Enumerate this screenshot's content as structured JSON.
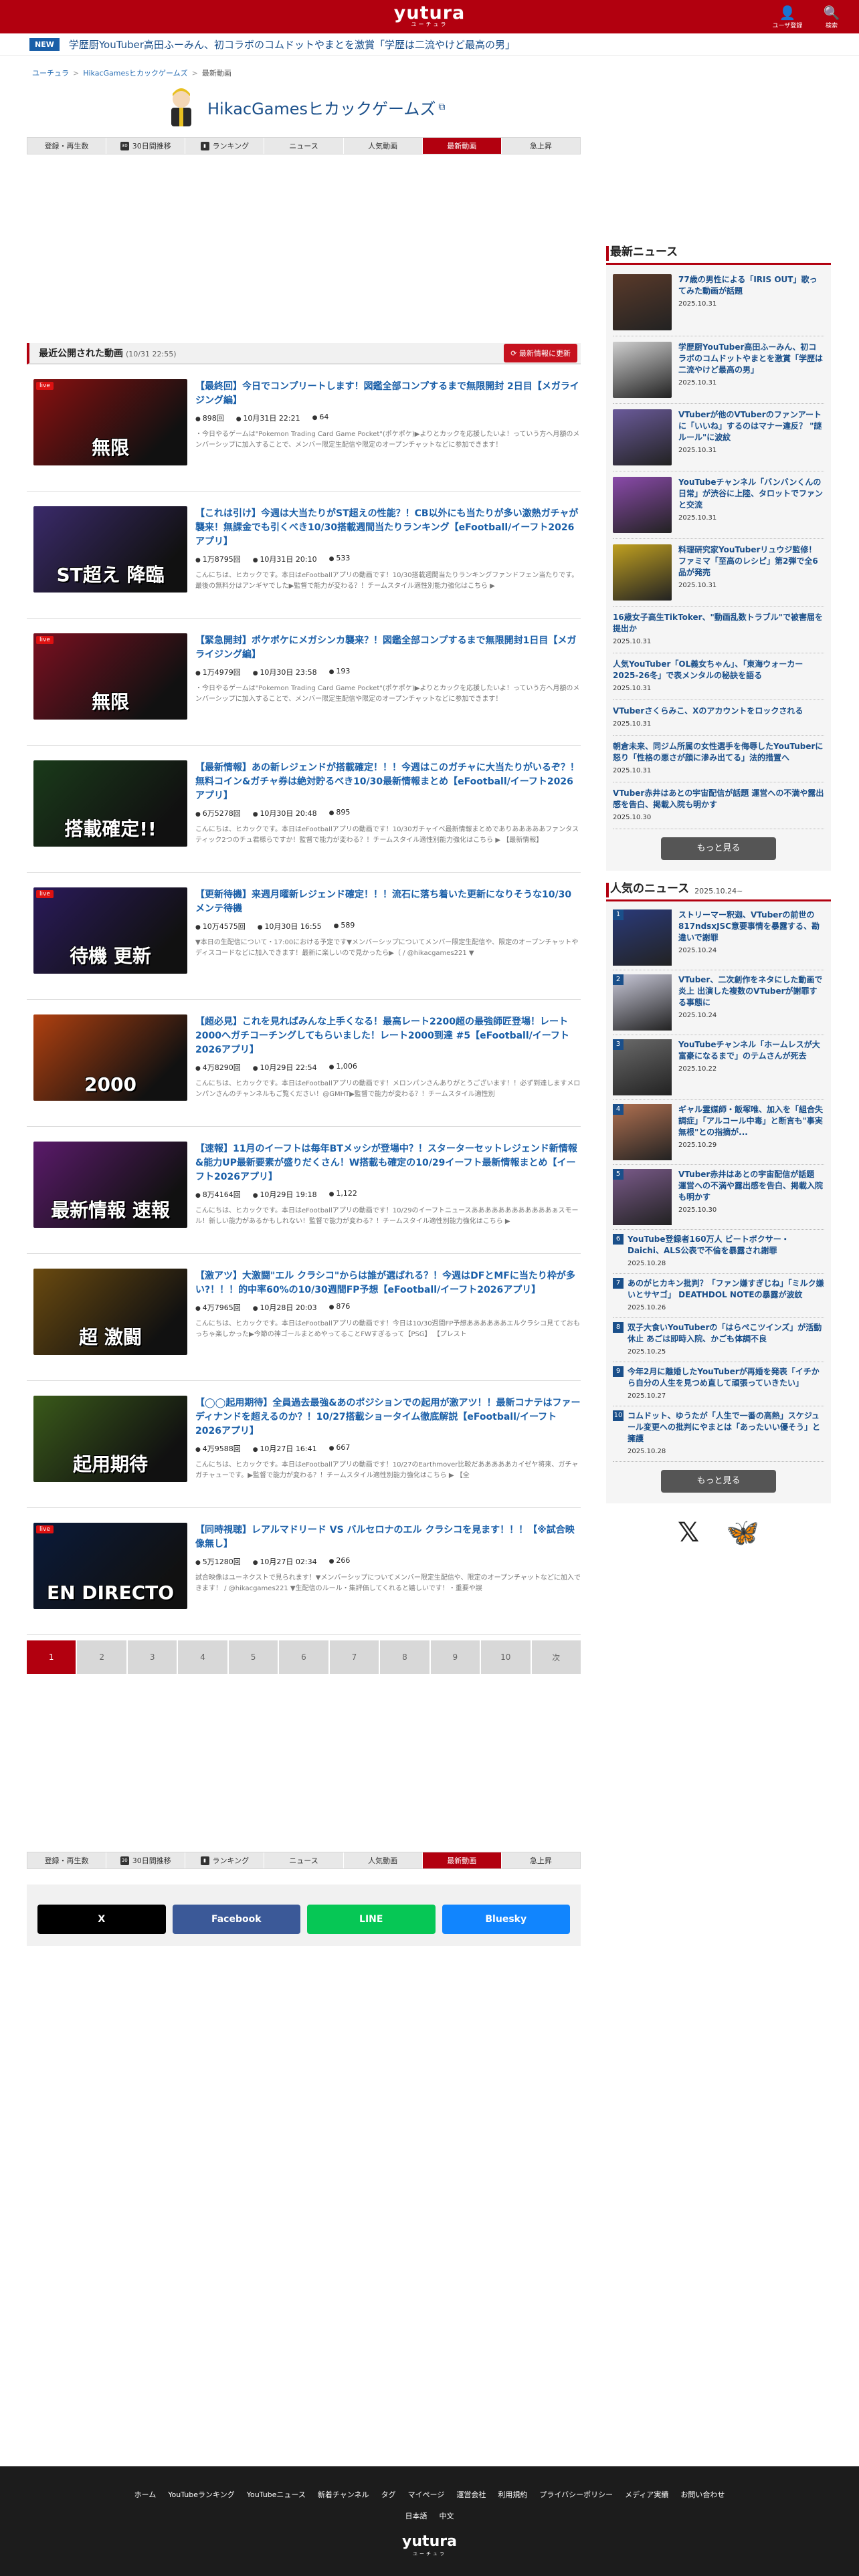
{
  "header": {
    "logo": "yutura",
    "logo_sub": "ユーチュラ",
    "user_label": "ユーザ登録",
    "search_label": "検索",
    "brand_color": "#b2000f"
  },
  "ticker": {
    "badge": "NEW",
    "text": "学歴厨YouTuber高田ふーみん、初コラボのコムドットやまとを激賞「学歴は二流やけど最高の男」"
  },
  "breadcrumb": [
    "ユーチュラ",
    "HikacGamesヒカックゲームズ",
    "最新動画"
  ],
  "channel": {
    "name": "HikacGamesヒカックゲームズ"
  },
  "tabs": [
    {
      "label": "登録・再生数",
      "icon": ""
    },
    {
      "label": "30日間推移",
      "icon": "30"
    },
    {
      "label": "ランキング",
      "icon": "rk"
    },
    {
      "label": "ニュース",
      "icon": ""
    },
    {
      "label": "人気動画",
      "icon": ""
    },
    {
      "label": "最新動画",
      "icon": "",
      "active": true
    },
    {
      "label": "急上昇",
      "icon": ""
    }
  ],
  "list": {
    "title": "最近公開された動画",
    "updated": "(10/31 22:55)",
    "refresh": "最新情報に更新"
  },
  "videos": [
    {
      "title": "【最終回】今日でコンプリートします！図鑑全部コンプするまで無限開封 2日目【メガライジング編】",
      "views": "898回",
      "date": "10月31日 22:21",
      "likes": "64",
      "desc": "・今日やるゲームは\"Pokemon Trading Card Game Pocket\"(ポケポケ)▶よりとカックを応援したいよ！っていう方へ月額のメンバーシップに加入することで、メンバー限定生配信や限定のオープンチャットなどに参加できます！",
      "live": true,
      "thumb": "無限",
      "color": "#8a1010"
    },
    {
      "title": "【これは引け】今週は大当たりがST超えの性能？！CB以外にも当たりが多い激熱ガチャが襲来！無課金でも引くべき10/30搭載週間当たりランキング【eFootball/イーフト2026アプリ】",
      "views": "1万8795回",
      "date": "10月31日 20:10",
      "likes": "533",
      "desc": "こんにちは、ヒカックです。本日はeFootballアプリの動画です！10/30搭載週間当たりランキングファンドフェン当たりです。最後の無料分はアンギヤでした▶監督で能力が変わる？！チームスタイル適性別能力強化はこちら ▶",
      "live": false,
      "thumb": "ST超え 降臨",
      "color": "#3a2a6a"
    },
    {
      "title": "【緊急開封】ポケポケにメガシンカ襲来？！図鑑全部コンプするまで無限開封1日目【メガライジング編】",
      "views": "1万4979回",
      "date": "10月30日 23:58",
      "likes": "193",
      "desc": "・今日やるゲームは\"Pokemon Trading Card Game Pocket\"(ポケポケ)▶よりとカックを応援したいよ！っていう方へ月額のメンバーシップに加入することで、メンバー限定生配信や限定のオープンチャットなどに参加できます！",
      "live": true,
      "thumb": "無限",
      "color": "#7a1020"
    },
    {
      "title": "【最新情報】あの新レジェンドが搭載確定！！！今週はこのガチャに大当たりがいるぞ？！無料コイン&ガチャ券は絶対貯るべき10/30最新情報まとめ【eFootball/イーフト2026アプリ】",
      "views": "6万5278回",
      "date": "10月30日 20:48",
      "likes": "895",
      "desc": "こんにちは、ヒカックです。本日はeFootballアプリの動画です！10/30ガチャイベ最新情報まとめでありあああああファンタスティック2つのチュ君様らですか！監督で能力が変わる？！チームスタイル適性別能力強化はこちら ▶ 【最新情報】",
      "live": false,
      "thumb": "搭載確定!!",
      "color": "#1a3a1a"
    },
    {
      "title": "【更新待機】来週月曜新レジェンド確定！！！流石に落ち着いた更新になりそうな10/30メンテ待機",
      "views": "10万4575回",
      "date": "10月30日 16:55",
      "likes": "589",
      "desc": "▼本日の生配信について・17:00における予定です▼メンバーシップについてメンバー限定生配信や、限定のオープンチャットやディスコードなどに加入できます！最新に楽しいので見かったら▶（ / @hikacgames221 ▼",
      "live": true,
      "thumb": "待機 更新",
      "color": "#2a1a5a"
    },
    {
      "title": "【超必見】これを見ればみんな上手くなる！最高レート2200超の最強師匠登場！レート2000へガチコーチングしてもらいました！レート2000到達 #5【eFootball/イーフト2026アプリ】",
      "views": "4万8290回",
      "date": "10月29日 22:54",
      "likes": "1,006",
      "desc": "こんにちは、ヒカックです。本日はeFootballアプリの動画です！メロンパンさんありがとうございます！！必ず到達しますメロンパンさんのチャンネルもご覧ください！@GMHT▶監督で能力が変わる？！チームスタイル適性別",
      "live": false,
      "thumb": "2000",
      "color": "#b04010"
    },
    {
      "title": "【速報】11月のイーフトは毎年BTメッシが登場中？！スターターセットレジェンド新情報&能力UP最新要素が盛りだくさん！W搭載も確定の10/29イーフト最新情報まとめ【イーフト2026アプリ】",
      "views": "8万4164回",
      "date": "10月29日 19:18",
      "likes": "1,122",
      "desc": "こんにちは、ヒカックです。本日はeFootballアプリの動画です！10/29のイーフトニュースああああああああああああぁスモール！新しい能力があるかもしれない！監督で能力が変わる？！チームスタイル適性別能力強化はこちら ▶",
      "live": false,
      "thumb": "最新情報 速報",
      "color": "#5a1a6a"
    },
    {
      "title": "【激アツ】大激闘\"エル クラシコ\"からは誰が選ばれる？！今週はDFとMFに当たり枠が多い?！！！的中率60%の10/30週間FP予想【eFootball/イーフト2026アプリ】",
      "views": "4万7965回",
      "date": "10月28日 20:03",
      "likes": "876",
      "desc": "こんにちは、ヒカックです。本日はeFootballアプリの動画です！今日は10/30週間FP予想ああああああエルクラシコ見てておもっちゃ楽しかった▶今節の神ゴールまとめやってることFWすぎるって【PSG】 【プレスト",
      "live": false,
      "thumb": "超 激闘",
      "color": "#6a4a10"
    },
    {
      "title": "【◯◯起用期待】全員過去最強&あのポジションでの起用が激アツ！！最新コナテはファーディナンドを超えるのか？！10/27搭載ショータイム徹底解説【eFootball/イーフト2026アプリ】",
      "views": "4万9588回",
      "date": "10月27日 16:41",
      "likes": "667",
      "desc": "こんにちは、ヒカックです。本日はeFootballアプリの動画です！10/27のEarthmover比較だあああああカイゼヤ将来、ガチャガチャューです。▶監督で能力が変わる？！チームスタイル適性別能力強化はこちら ▶ 【全",
      "live": false,
      "thumb": "起用期待",
      "color": "#3a5a1a"
    },
    {
      "title": "【同時視聴】レアルマドリード VS バルセロナのエル クラシコを見ます！！！【※試合映像無し】",
      "views": "5万1280回",
      "date": "10月27日 02:34",
      "likes": "266",
      "desc": "試合映像はユーネクストで見られます！▼メンバーシップについてメンバー限定生配信や、限定のオープンチャットなどに加入できます！ / @hikacgames221 ▼生配信のルール・集評価してくれると嬉しいです！・重要や誤",
      "live": true,
      "thumb": "EN DIRECTO",
      "color": "#0a1a3a"
    }
  ],
  "pager": [
    "1",
    "2",
    "3",
    "4",
    "5",
    "6",
    "7",
    "8",
    "9",
    "10",
    "次"
  ],
  "share": [
    {
      "label": "X",
      "color": "#000000"
    },
    {
      "label": "Facebook",
      "color": "#3b5998"
    },
    {
      "label": "LINE",
      "color": "#06c755"
    },
    {
      "label": "Bluesky",
      "color": "#1185fe"
    }
  ],
  "latest_news": {
    "title": "最新ニュース",
    "items": [
      {
        "text": "77歳の男性による「IRIS OUT」歌ってみた動画が話題",
        "date": "2025.10.31",
        "color": "#5a3a2a"
      },
      {
        "text": "学歴厨YouTuber高田ふーみん、初コラボのコムドットやまとを激賞「学歴は二流やけど最高の男」",
        "date": "2025.10.31",
        "color": "#cfcfcf"
      },
      {
        "text": "VTuberが他のVTuberのファンアートに「いいね」するのはマナー違反？ \"謎ルール\"に波紋",
        "date": "2025.10.31",
        "color": "#6a5a9a"
      },
      {
        "text": "YouTubeチャンネル「バンバンくんの日常」が渋谷に上陸、タロットでファンと交流",
        "date": "2025.10.31",
        "color": "#8a4aaa"
      },
      {
        "text": "料理研究家YouTuberリュウジ監修！ファミマ「至高のレシピ」第2弾で全6品が発売",
        "date": "2025.10.31",
        "color": "#c0a020"
      }
    ],
    "text_items": [
      {
        "text": "16歳女子高生TikToker、\"動画乱数トラブル\"で被害届を提出か",
        "date": "2025.10.31"
      },
      {
        "text": "人気YouTuber「OL義女ちゃん」、「東海ウォーカー2025-26冬」で表メンタルの秘訣を語る",
        "date": "2025.10.31"
      },
      {
        "text": "VTuberさくらみこ、Xのアカウントをロックされる",
        "date": "2025.10.31"
      },
      {
        "text": "朝倉未来、同ジム所属の女性選手を侮辱したYouTuberに怒り「性格の悪さが顔に滲み出てる」法的措置へ",
        "date": "2025.10.31"
      },
      {
        "text": "VTuber赤井はあとの宇宙配信が話題 運営への不満や露出感を告白、掲載入院も明かす",
        "date": "2025.10.30"
      }
    ],
    "more": "もっと見る"
  },
  "popular_news": {
    "title": "人気のニュース",
    "range": "2025.10.24~",
    "items": [
      {
        "rank": "1",
        "text": "ストリーマー釈迦、VTuberの前世の817ndsxJSC意要事情を暴露する、勘違いで謝罪",
        "date": "2025.10.24",
        "color": "#2a3a7a"
      },
      {
        "rank": "2",
        "text": "VTuber、二次創作をネタにした動画で炎上 出演した複数のVTuberが謝罪する事態に",
        "date": "2025.10.24",
        "color": "#c8c8d8"
      },
      {
        "rank": "3",
        "text": "YouTubeチャンネル「ホームレスが大富豪になるまで」のテムさんが死去",
        "date": "2025.10.22",
        "color": "#6a6a6a"
      },
      {
        "rank": "4",
        "text": "ギャル霊媒師・飯塚唯、加入を「組合失調症」「アルコール中毒」と断言も\"事実無根\"との指摘が...",
        "date": "2025.10.29",
        "color": "#b07050"
      },
      {
        "rank": "5",
        "text": "VTuber赤井はあとの宇宙配信が話題 運営への不満や露出感を告白、掲載入院も明かす",
        "date": "2025.10.30",
        "color": "#7a5a8a"
      }
    ],
    "text_items": [
      {
        "rank": "6",
        "text": "YouTube登録者160万人 ビートボクサー・Daichi、ALS公表で不倫を暴露され謝罪",
        "date": "2025.10.28"
      },
      {
        "rank": "7",
        "text": "あのがヒカキン批判？「ファン嫌すぎじね」「ミルク嫌いとサヤゴ」 DEATHDOL NOTEの暴露が波紋",
        "date": "2025.10.26"
      },
      {
        "rank": "8",
        "text": "双子大食いYouTuberの「はらぺこツインズ」が活動休止 あごは即時入院、かごも体調不良",
        "date": "2025.10.25"
      },
      {
        "rank": "9",
        "text": "今年2月に離婚したYouTuberが再婚を発表「イチから自分の人生を見つめ直して頑張っていきたい」",
        "date": "2025.10.27"
      },
      {
        "rank": "10",
        "text": "コムドット、ゆうたが「人生で一番の高熱」スケジュール変更への批判にやまとは「あったいい優そう」と擁護",
        "date": "2025.10.28"
      }
    ],
    "more": "もっと見る"
  },
  "footer": {
    "links": [
      "ホーム",
      "YouTubeランキング",
      "YouTubeニュース",
      "新着チャンネル",
      "タグ",
      "マイページ",
      "運営会社",
      "利用規約",
      "プライバシーポリシー",
      "メディア実績",
      "お問い合わせ"
    ],
    "langs": [
      "日本語",
      "中文"
    ],
    "logo": "yutura",
    "logo_sub": "ユーチュラ"
  }
}
